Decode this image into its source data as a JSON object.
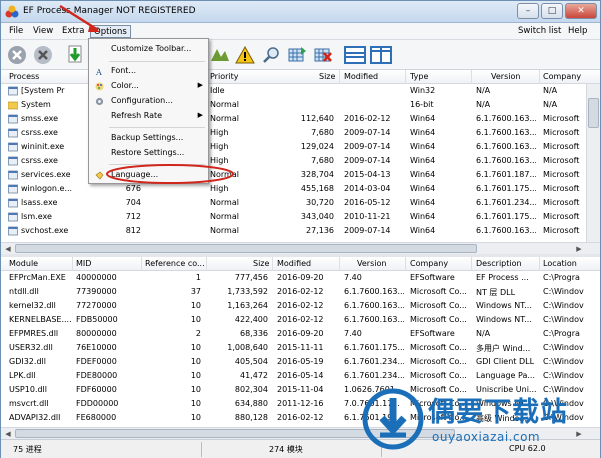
{
  "window": {
    "title": "EF Process Manager NOT REGISTERED",
    "min_label": "–",
    "max_label": "□",
    "close_label": "✕"
  },
  "menu": {
    "file": "File",
    "view": "View",
    "extra": "Extra",
    "options": "Options",
    "switch_list": "Switch list",
    "help": "Help"
  },
  "options_menu": {
    "items": [
      {
        "label": "Customize Toolbar...",
        "submenu": ""
      },
      {
        "label": "Font...",
        "submenu": ""
      },
      {
        "label": "Color...",
        "submenu": "▶"
      },
      {
        "label": "Configuration...",
        "submenu": ""
      },
      {
        "label": "Refresh Rate",
        "submenu": "▶"
      },
      {
        "label": "Backup Settings...",
        "submenu": ""
      },
      {
        "label": "Restore Settings...",
        "submenu": ""
      },
      {
        "label": "Language...",
        "submenu": ""
      }
    ]
  },
  "process_table": {
    "headers": [
      "Process",
      "Priority",
      "Size",
      "Modified",
      "Type",
      "Version",
      "Company"
    ],
    "rows": [
      {
        "process": "[System Pr",
        "pid": "",
        "priority": "Idle",
        "size": "",
        "modified": "",
        "type": "Win32",
        "version": "N/A",
        "company": "N/A"
      },
      {
        "process": "System",
        "pid": "",
        "priority": "Normal",
        "size": "",
        "modified": "",
        "type": "16-bit",
        "version": "N/A",
        "company": "N/A"
      },
      {
        "process": "smss.exe",
        "pid": "",
        "priority": "Normal",
        "size": "112,640",
        "modified": "2016-02-12",
        "type": "Win64",
        "version": "6.1.7600.163...",
        "company": "Microsoft"
      },
      {
        "process": "csrss.exe",
        "pid": "",
        "priority": "High",
        "size": "7,680",
        "modified": "2009-07-14",
        "type": "Win64",
        "version": "6.1.7600.163...",
        "company": "Microsoft"
      },
      {
        "process": "wininit.exe",
        "pid": "",
        "priority": "High",
        "size": "129,024",
        "modified": "2009-07-14",
        "type": "Win64",
        "version": "6.1.7600.163...",
        "company": "Microsoft"
      },
      {
        "process": "csrss.exe",
        "pid": "",
        "priority": "High",
        "size": "7,680",
        "modified": "2009-07-14",
        "type": "Win64",
        "version": "6.1.7600.163...",
        "company": "Microsoft"
      },
      {
        "process": "services.exe",
        "pid": "",
        "priority": "Normal",
        "size": "328,704",
        "modified": "2015-04-13",
        "type": "Win64",
        "version": "6.1.7601.187...",
        "company": "Microsoft"
      },
      {
        "process": "winlogon.e...",
        "pid": "676",
        "priority": "High",
        "size": "455,168",
        "modified": "2014-03-04",
        "type": "Win64",
        "version": "6.1.7601.175...",
        "company": "Microsoft"
      },
      {
        "process": "lsass.exe",
        "pid": "704",
        "priority": "Normal",
        "size": "30,720",
        "modified": "2016-05-12",
        "type": "Win64",
        "version": "6.1.7601.234...",
        "company": "Microsoft"
      },
      {
        "process": "lsm.exe",
        "pid": "712",
        "priority": "Normal",
        "size": "343,040",
        "modified": "2010-11-21",
        "type": "Win64",
        "version": "6.1.7601.175...",
        "company": "Microsoft"
      },
      {
        "process": "svchost.exe",
        "pid": "812",
        "priority": "Normal",
        "size": "27,136",
        "modified": "2009-07-14",
        "type": "Win64",
        "version": "6.1.7600.163...",
        "company": "Microsoft"
      }
    ]
  },
  "module_table": {
    "headers": [
      "Module",
      "MID",
      "Reference co...",
      "Size",
      "Modified",
      "Version",
      "Company",
      "Description",
      "Location"
    ],
    "rows": [
      {
        "module": "EFPrcMan.EXE",
        "mid": "40000000",
        "ref": "1",
        "size": "777,456",
        "modified": "2016-09-20",
        "version": "7.40",
        "company": "EFSoftware",
        "description": "EF Process ...",
        "location": "C:\\Progra"
      },
      {
        "module": "ntdll.dll",
        "mid": "77390000",
        "ref": "37",
        "size": "1,733,592",
        "modified": "2016-02-12",
        "version": "6.1.7600.163...",
        "company": "Microsoft Co...",
        "description": "NT 层 DLL",
        "location": "C:\\Windov"
      },
      {
        "module": "kernel32.dll",
        "mid": "77270000",
        "ref": "10",
        "size": "1,163,264",
        "modified": "2016-02-12",
        "version": "6.1.7600.163...",
        "company": "Microsoft Co...",
        "description": "Windows NT...",
        "location": "C:\\Windov"
      },
      {
        "module": "KERNELBASE....",
        "mid": "FDB50000",
        "ref": "10",
        "size": "422,400",
        "modified": "2016-02-12",
        "version": "6.1.7600.163...",
        "company": "Microsoft Co...",
        "description": "Windows NT...",
        "location": "C:\\Windov"
      },
      {
        "module": "EFPMRES.dll",
        "mid": "80000000",
        "ref": "2",
        "size": "68,336",
        "modified": "2016-09-20",
        "version": "7.40",
        "company": "EFSoftware",
        "description": "N/A",
        "location": "C:\\Progra"
      },
      {
        "module": "USER32.dll",
        "mid": "76E10000",
        "ref": "10",
        "size": "1,008,640",
        "modified": "2015-11-11",
        "version": "6.1.7601.175...",
        "company": "Microsoft Co...",
        "description": "多用户 Wind...",
        "location": "C:\\Windov"
      },
      {
        "module": "GDI32.dll",
        "mid": "FDEF0000",
        "ref": "10",
        "size": "405,504",
        "modified": "2016-05-19",
        "version": "6.1.7601.234...",
        "company": "Microsoft Co...",
        "description": "GDI Client DLL",
        "location": "C:\\Windov"
      },
      {
        "module": "LPK.dll",
        "mid": "FDE80000",
        "ref": "10",
        "size": "41,472",
        "modified": "2016-05-14",
        "version": "6.1.7601.234...",
        "company": "Microsoft Co...",
        "description": "Language Pa...",
        "location": "C:\\Windov"
      },
      {
        "module": "USP10.dll",
        "mid": "FDF60000",
        "ref": "10",
        "size": "802,304",
        "modified": "2015-11-04",
        "version": "1.0626.7601...",
        "company": "Microsoft Co...",
        "description": "Uniscribe Uni...",
        "location": "C:\\Windov"
      },
      {
        "module": "msvcrt.dll",
        "mid": "FDD00000",
        "ref": "10",
        "size": "634,880",
        "modified": "2011-12-16",
        "version": "7.0.7601.17...",
        "company": "Microsoft Co...",
        "description": "Windows NT...",
        "location": "C:\\Windov"
      },
      {
        "module": "ADVAPI32.dll",
        "mid": "FE680000",
        "ref": "10",
        "size": "880,128",
        "modified": "2016-02-12",
        "version": "6.1.7601.191...",
        "company": "Microsoft Co...",
        "description": "高级 Windo...",
        "location": "C:\\Windov"
      }
    ]
  },
  "status": {
    "processes": "75 进程",
    "modules": "274 模块",
    "cpu": "CPU 62.0"
  },
  "watermark": {
    "text_cn": "偶要下载站",
    "url": "ouyaoxiazai.com"
  }
}
